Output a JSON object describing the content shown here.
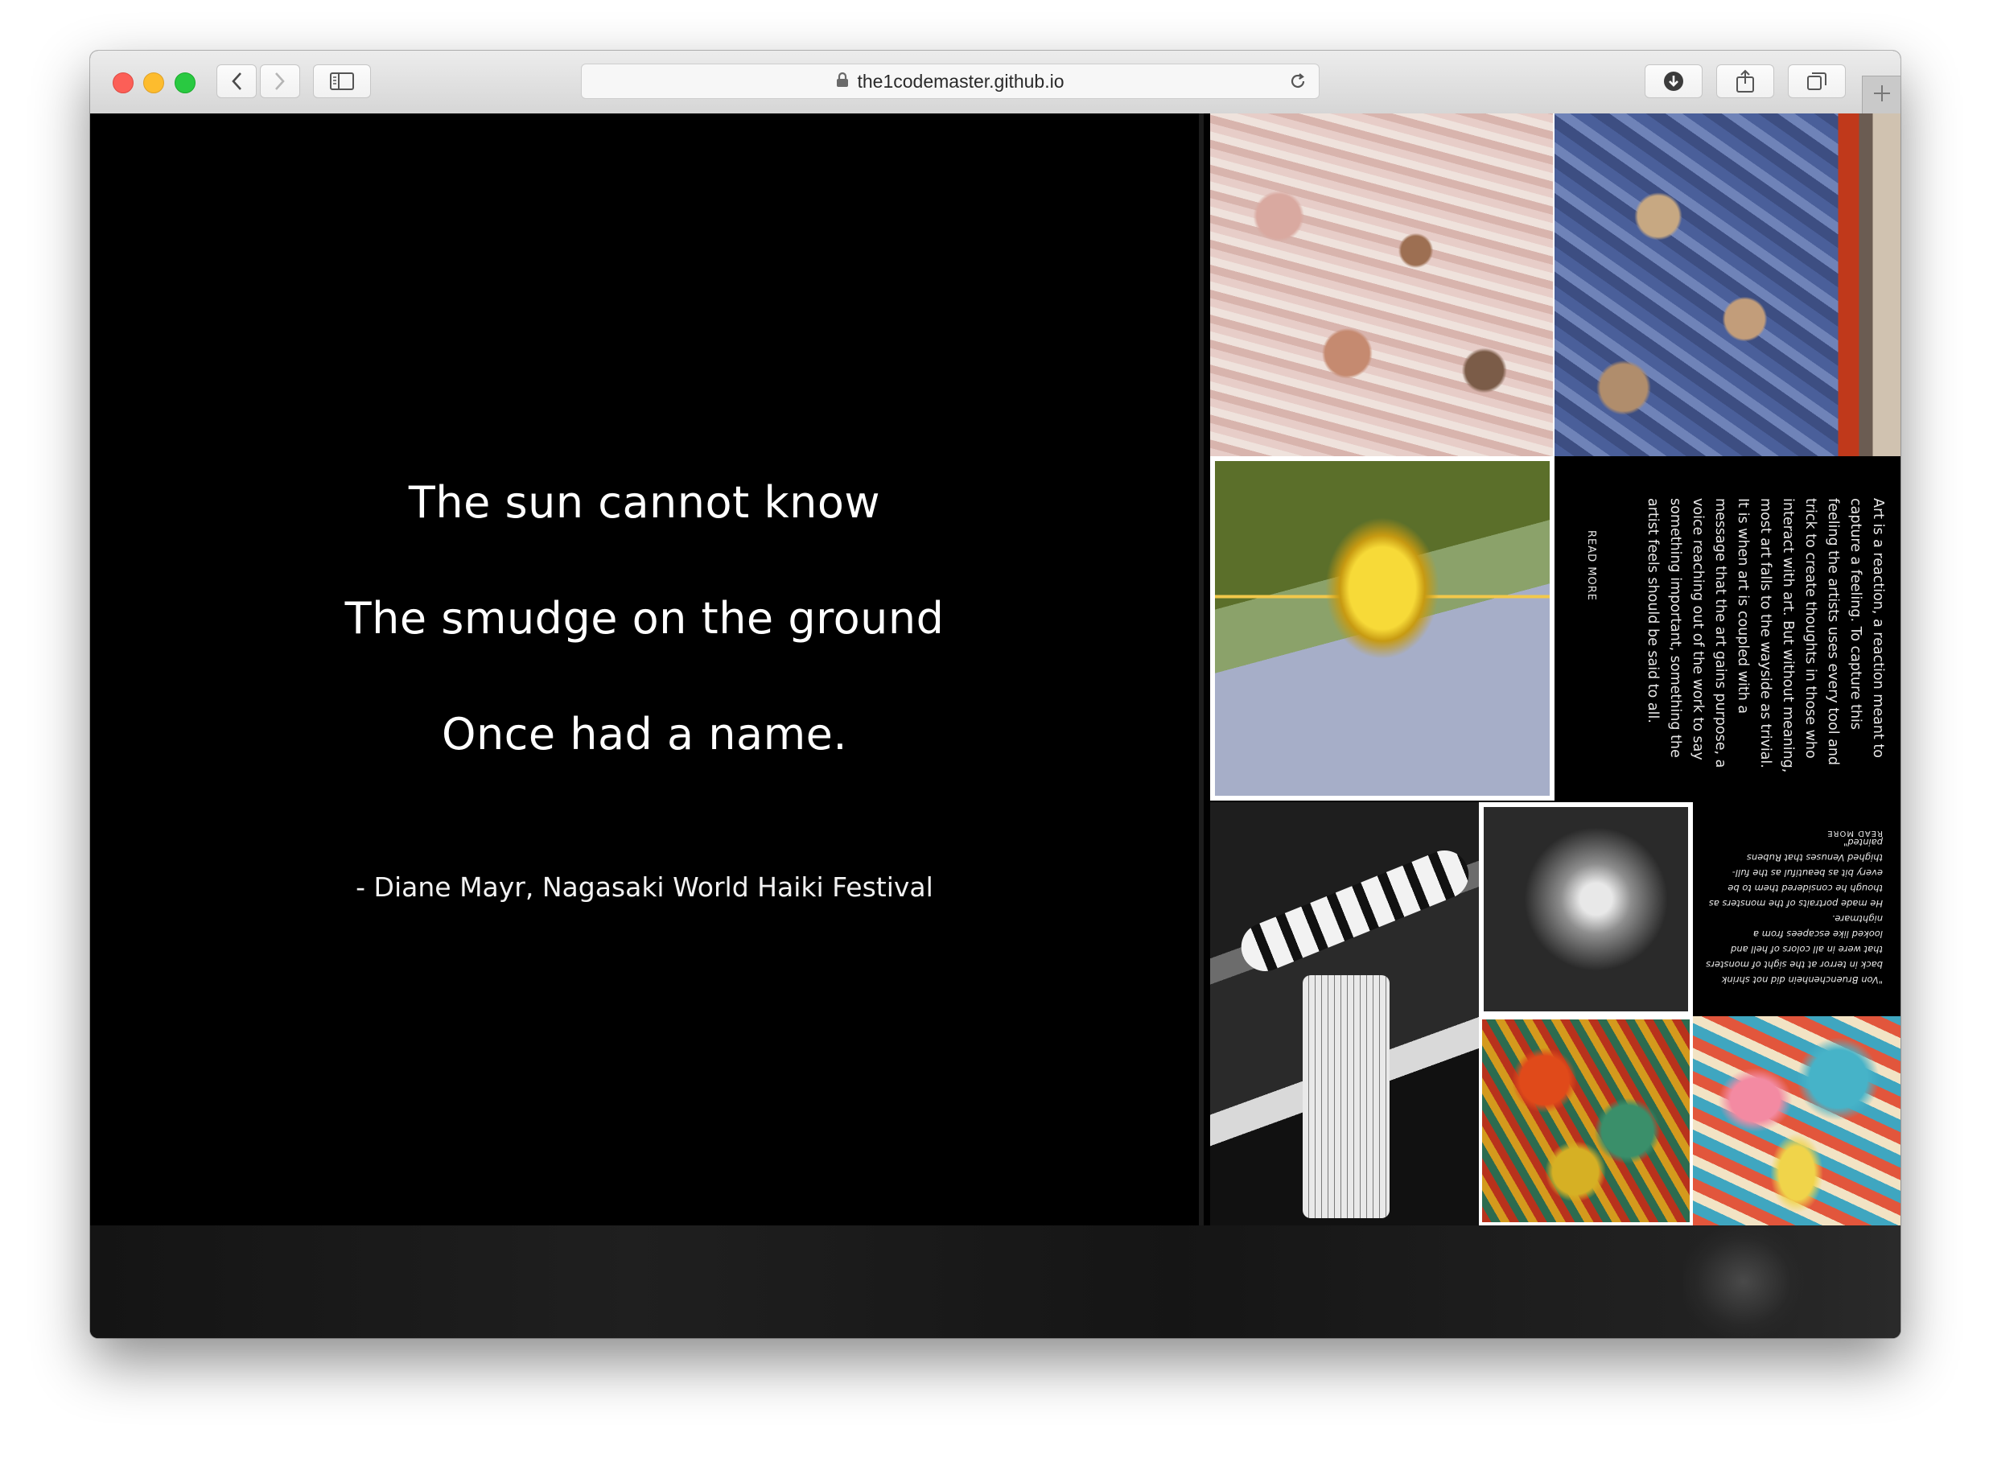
{
  "browser": {
    "url": "the1codemaster.github.io",
    "icons": {
      "back": "chevron-left-icon",
      "forward": "chevron-right-icon",
      "sidebar": "sidebar-icon",
      "lock": "lock-icon",
      "reload": "reload-icon",
      "downloads": "download-icon",
      "share": "share-icon",
      "tabs": "tabs-icon",
      "new_tab": "plus-icon"
    }
  },
  "poem": {
    "line1": "The sun cannot know",
    "line2": "The smudge on the ground",
    "line3": "Once had a name.",
    "credit": "- Diane Mayr, Nagasaki World Haiki Festival"
  },
  "gallery": {
    "article1": {
      "body": "Art is a reaction, a reaction meant to\ncapture a feeling.  To capture this\nfeeling the artists uses every tool and\ntrick to create thoughts in those who\ninteract with art. But without meaning,\nmost art falls to the wayside as trivial.\nIt is when art is coupled with a\nmessage that the art gains purpose, a\nvoice reaching out of the work to say\nsomething important, something the\nartist feels should be said to all.",
      "read_more": "READ MORE"
    },
    "article2": {
      "body": "\"Von Bruenchenhein did not shrink\nback in terror at the sight of monsters\nthat were in all colors of hell and\nlooked like escapees from a nightmare.\nHe made portraits of the monsters as\nthough he considered them to be\nevery bit as beautiful as the full-\nthighed Venuses that Rubens painted\"",
      "read_more": "READ MORE"
    }
  },
  "colors": {
    "page_background": "#000000",
    "text": "#ffffff",
    "toolbar": "#dcdcdc"
  }
}
